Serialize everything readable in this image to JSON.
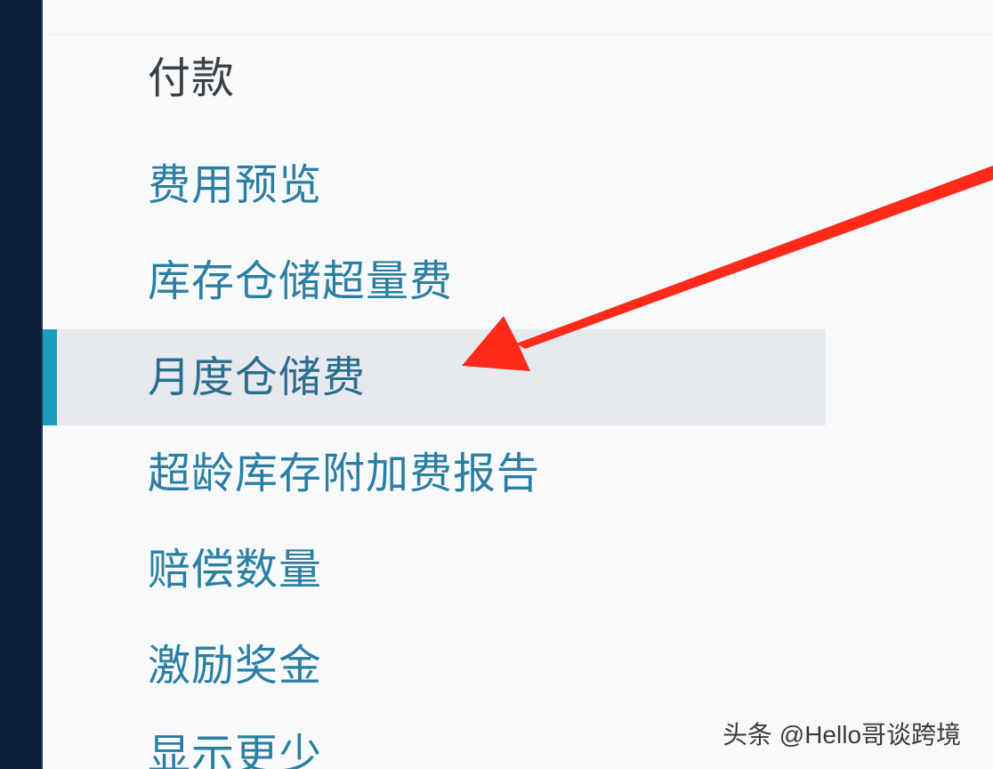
{
  "menu": {
    "section_title": "付款",
    "items": [
      {
        "label": "费用预览",
        "active": false
      },
      {
        "label": "库存仓储超量费",
        "active": false
      },
      {
        "label": "月度仓储费",
        "active": true
      },
      {
        "label": "超龄库存附加费报告",
        "active": false
      },
      {
        "label": "赔偿数量",
        "active": false
      },
      {
        "label": "激励奖金",
        "active": false
      },
      {
        "label": "显示更少",
        "active": false
      }
    ]
  },
  "annotation": {
    "arrow_color": "#ff2a1a",
    "arrow_icon": "red-arrow-pointer-icon"
  },
  "watermark": {
    "text": "头条 @Hello哥谈跨境"
  },
  "colors": {
    "rail": "#0b1f3a",
    "link": "#2b7fa3",
    "active_bg": "#e6e9ee",
    "active_indicator": "#1f9bbd"
  }
}
